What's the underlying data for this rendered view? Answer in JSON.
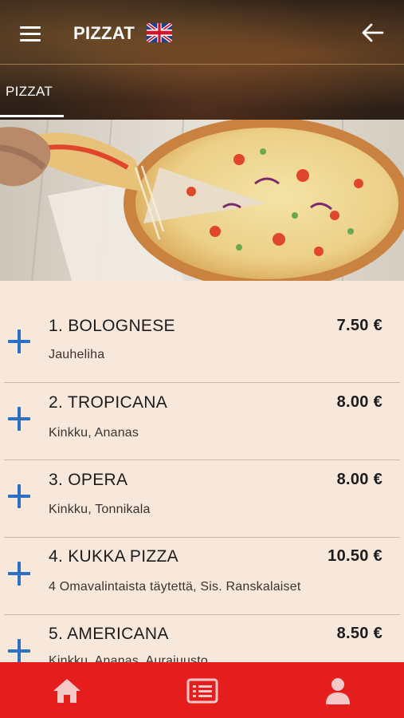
{
  "header": {
    "title": "PIZZAT",
    "tab_label": "PIZZAT"
  },
  "menu": {
    "items": [
      {
        "number_name": "1. BOLOGNESE",
        "price": "7.50 €",
        "description": "Jauheliha"
      },
      {
        "number_name": "2. TROPICANA",
        "price": "8.00 €",
        "description": "Kinkku, Ananas"
      },
      {
        "number_name": "3. OPERA",
        "price": "8.00 €",
        "description": "Kinkku, Tonnikala"
      },
      {
        "number_name": "4. KUKKA PIZZA",
        "price": "10.50 €",
        "description": "4 Omavalintaista täytettä, Sis. Ranskalaiset"
      },
      {
        "number_name": "5. AMERICANA",
        "price": "8.50 €",
        "description": "Kinkku, Ananas, Aurajuusto"
      }
    ]
  },
  "icons": {
    "menu": "hamburger-menu-icon",
    "language": "uk-flag-icon",
    "back": "arrow-left-icon",
    "add": "plus-icon",
    "home": "home-icon",
    "list": "menu-list-icon",
    "profile": "user-icon"
  },
  "colors": {
    "accent_blue": "#2d6fc1",
    "bottom_bar": "#e51d1d",
    "list_background": "#f8e8dc",
    "nav_icon": "#f6c9c9"
  }
}
